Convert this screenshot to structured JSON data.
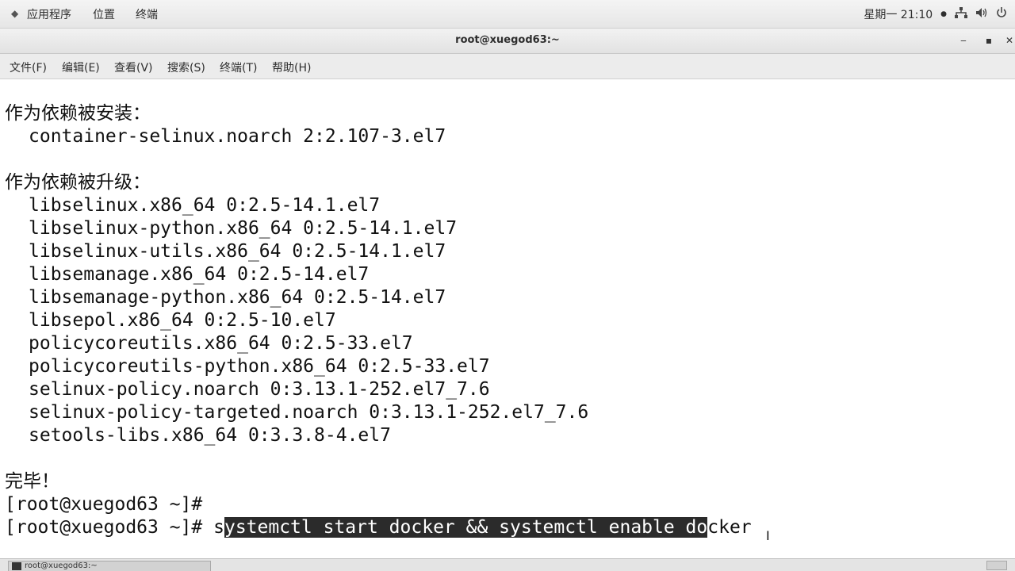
{
  "top_panel": {
    "apps_label": "应用程序",
    "places_label": "位置",
    "terminal_label": "终端",
    "clock": "星期一 21:10",
    "clock_dot": "●"
  },
  "window": {
    "title": "root@xuegod63:~",
    "minimize": "‒",
    "maximize": "▪",
    "close": "✕"
  },
  "menubar": {
    "items": [
      "文件(F)",
      "编辑(E)",
      "查看(V)",
      "搜索(S)",
      "终端(T)",
      "帮助(H)"
    ]
  },
  "terminal": {
    "lines": [
      "作为依赖被安装：",
      "container-selinux.noarch 2:2.107-3.el7",
      "",
      "作为依赖被升级：",
      "libselinux.x86_64 0:2.5-14.1.el7",
      "libselinux-python.x86_64 0:2.5-14.1.el7",
      "libselinux-utils.x86_64 0:2.5-14.1.el7",
      "libsemanage.x86_64 0:2.5-14.el7",
      "libsemanage-python.x86_64 0:2.5-14.el7",
      "libsepol.x86_64 0:2.5-10.el7",
      "policycoreutils.x86_64 0:2.5-33.el7",
      "policycoreutils-python.x86_64 0:2.5-33.el7",
      "selinux-policy.noarch 0:3.13.1-252.el7_7.6",
      "selinux-policy-targeted.noarch 0:3.13.1-252.el7_7.6",
      "setools-libs.x86_64 0:3.3.8-4.el7",
      "",
      "完毕！",
      "[root@xuegod63 ~]#"
    ],
    "prompt": "[root@xuegod63 ~]# ",
    "cmd_pre": "s",
    "cmd_selected": "ystemctl start docker && systemctl enable do",
    "cmd_post": "cker"
  },
  "taskbar": {
    "item_label": "root@xuegod63:~"
  }
}
